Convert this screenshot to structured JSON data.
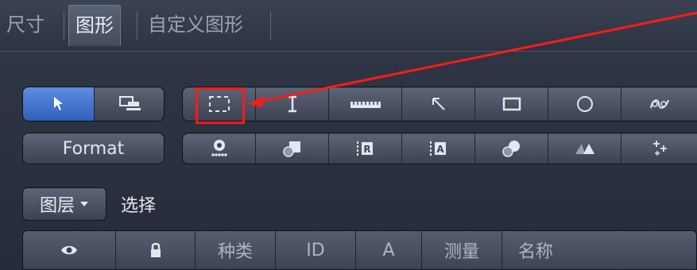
{
  "tabs": [
    {
      "label": "尺寸",
      "active": false
    },
    {
      "label": "图形",
      "active": true
    },
    {
      "label": "自定义图形",
      "active": false
    }
  ],
  "toolbar": {
    "format_label": "Format",
    "row1_selector": [
      "pointer-icon",
      "monitor-icon"
    ],
    "row1_tools": [
      "dashed-rectangle-icon",
      "text-cursor-icon",
      "ruler-icon",
      "arrow-line-icon",
      "rectangle-icon",
      "circle-icon",
      "curve-icon"
    ],
    "row2_tools": [
      "scale-bar-icon",
      "shape-overlay-icon",
      "region-r-icon",
      "region-a-icon",
      "shapes-circle-icon",
      "triangles-icon",
      "sparkle-icon"
    ]
  },
  "layers": {
    "dropdown_label": "图层",
    "select_label": "选择"
  },
  "table": {
    "headers": [
      {
        "type": "icon",
        "icon": "eye-icon",
        "text": ""
      },
      {
        "type": "icon",
        "icon": "lock-icon",
        "text": ""
      },
      {
        "type": "text",
        "text": "种类"
      },
      {
        "type": "text",
        "text": "ID"
      },
      {
        "type": "text",
        "text": "A"
      },
      {
        "type": "text",
        "text": "测量"
      },
      {
        "type": "text",
        "text": "名称"
      }
    ]
  },
  "annotation": {
    "color": "#ff1a1a"
  }
}
